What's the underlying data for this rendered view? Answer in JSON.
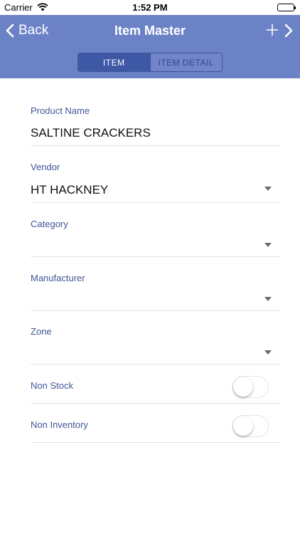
{
  "status_bar": {
    "carrier": "Carrier",
    "time": "1:52 PM"
  },
  "nav": {
    "back_label": "Back",
    "title": "Item Master",
    "add_icon": "plus-icon",
    "next_icon": "chevron-right-icon"
  },
  "tabs": [
    {
      "label": "ITEM",
      "active": true
    },
    {
      "label": "ITEM DETAIL",
      "active": false
    }
  ],
  "form": {
    "product_name": {
      "label": "Product Name",
      "value": "SALTINE CRACKERS"
    },
    "vendor": {
      "label": "Vendor",
      "value": "HT HACKNEY"
    },
    "category": {
      "label": "Category",
      "value": ""
    },
    "manufacturer": {
      "label": "Manufacturer",
      "value": ""
    },
    "zone": {
      "label": "Zone",
      "value": ""
    },
    "non_stock": {
      "label": "Non Stock",
      "on": false
    },
    "non_inventory": {
      "label": "Non Inventory",
      "on": false
    }
  },
  "colors": {
    "nav_background": "#6b82c6",
    "tab_active": "#3f58a6",
    "label_text": "#3f5696"
  }
}
